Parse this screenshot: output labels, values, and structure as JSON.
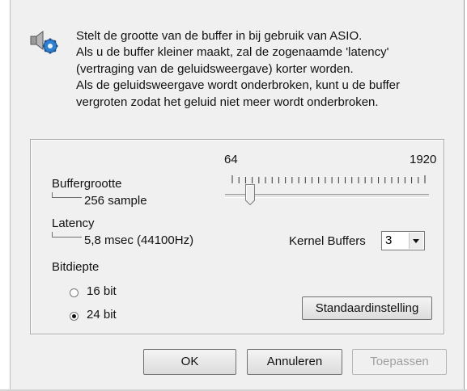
{
  "description": [
    "Stelt de grootte van de buffer in bij gebruik van ASIO.",
    "Als u de buffer kleiner maakt, zal de zogenaamde 'latency'",
    "(vertraging van de geluidsweergave) korter worden.",
    "Als de geluidsweergave wordt onderbroken, kunt u de buffer",
    "vergroten zodat het geluid niet meer wordt onderbroken."
  ],
  "buffer": {
    "label": "Buffergrootte",
    "value": "256 sample",
    "slider_min": "64",
    "slider_max": "1920"
  },
  "latency": {
    "label": "Latency",
    "value": "5,8 msec (44100Hz)"
  },
  "kernel_buffers": {
    "label": "Kernel Buffers",
    "value": "3"
  },
  "bitdepth": {
    "label": "Bitdiepte",
    "options": [
      {
        "label": "16 bit",
        "selected": false
      },
      {
        "label": "24 bit",
        "selected": true
      }
    ]
  },
  "buttons": {
    "defaults": "Standaardinstelling",
    "ok": "OK",
    "cancel": "Annuleren",
    "apply": "Toepassen"
  }
}
